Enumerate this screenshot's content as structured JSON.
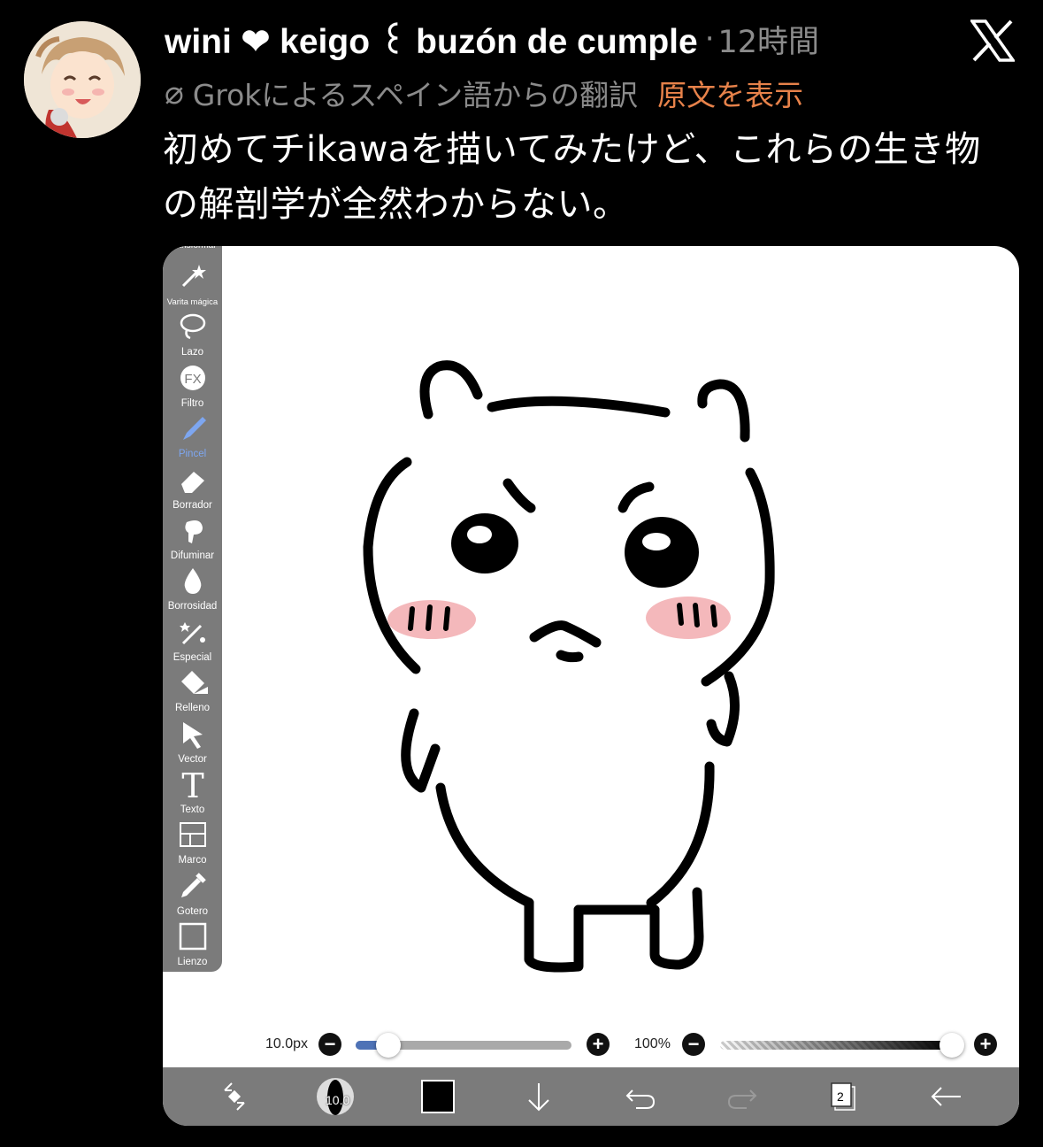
{
  "tweet": {
    "display_name": "wini ❤ keigo ꒰ buzón de cumple",
    "separator": "·",
    "timestamp": "12時間",
    "translation_notice": "Grokによるスペイン語からの翻訳",
    "show_original": "原文を表示",
    "text_line1": "初めてチikawaを描いてみたけど、これらの生き物",
    "text_line2": "の解剖学が全然わからない。"
  },
  "app": {
    "tools": [
      {
        "label": "Transformar",
        "icon": "transform-icon"
      },
      {
        "label": "Varita mágica",
        "icon": "magic-wand-icon"
      },
      {
        "label": "Lazo",
        "icon": "lasso-icon"
      },
      {
        "label": "Filtro",
        "icon": "fx-icon"
      },
      {
        "label": "Pincel",
        "icon": "brush-icon",
        "active": true
      },
      {
        "label": "Borrador",
        "icon": "eraser-icon"
      },
      {
        "label": "Difuminar",
        "icon": "smudge-icon"
      },
      {
        "label": "Borrosidad",
        "icon": "blur-drop-icon"
      },
      {
        "label": "Especial",
        "icon": "special-wand-icon"
      },
      {
        "label": "Relleno",
        "icon": "fill-bucket-icon"
      },
      {
        "label": "Vector",
        "icon": "vector-arrow-icon"
      },
      {
        "label": "Texto",
        "icon": "text-T-icon"
      },
      {
        "label": "Marco",
        "icon": "frame-icon"
      },
      {
        "label": "Gotero",
        "icon": "eyedropper-icon"
      },
      {
        "label": "Lienzo",
        "icon": "canvas-icon"
      }
    ],
    "brush_size": "10.0px",
    "brush_size_fraction": 0.15,
    "opacity": "100%",
    "opacity_fraction": 1.0,
    "brush_preview_label": "10.0",
    "layer_count": "2",
    "colors": {
      "toolbar": "#7b7b7b",
      "accent": "#4e72b6",
      "blush": "#f4b8bb"
    }
  }
}
